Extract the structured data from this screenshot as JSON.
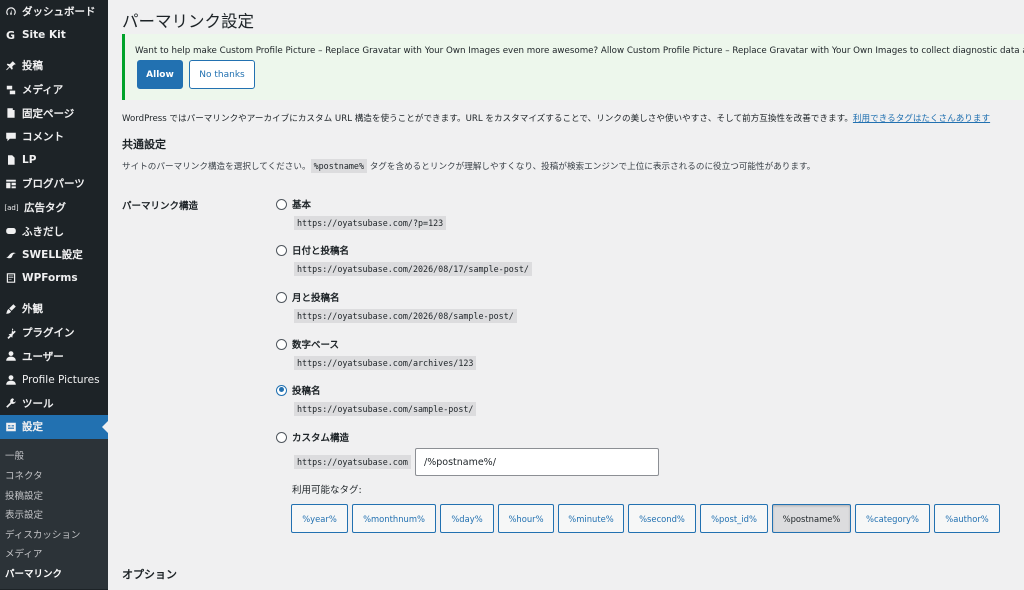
{
  "sidebar": {
    "items": [
      {
        "label": "ダッシュボード",
        "icon": "dashboard-icon"
      },
      {
        "label": "Site Kit",
        "icon": "site-kit-icon"
      },
      {
        "label": "投稿",
        "icon": "pin-icon"
      },
      {
        "label": "メディア",
        "icon": "media-icon"
      },
      {
        "label": "固定ページ",
        "icon": "page-icon"
      },
      {
        "label": "コメント",
        "icon": "comment-icon"
      },
      {
        "label": "LP",
        "icon": "document-icon"
      },
      {
        "label": "ブログパーツ",
        "icon": "blocks-icon"
      },
      {
        "label": "広告タグ",
        "icon": "ad-icon",
        "icon_text": "[ad]"
      },
      {
        "label": "ふきだし",
        "icon": "speech-bubble-icon"
      },
      {
        "label": "SWELL設定",
        "icon": "swell-icon"
      },
      {
        "label": "WPForms",
        "icon": "wpforms-icon"
      },
      {
        "label": "外観",
        "icon": "brush-icon"
      },
      {
        "label": "プラグイン",
        "icon": "plugin-icon"
      },
      {
        "label": "ユーザー",
        "icon": "user-icon"
      },
      {
        "label": "Profile Pictures",
        "icon": "profile-icon"
      },
      {
        "label": "ツール",
        "icon": "wrench-icon"
      },
      {
        "label": "設定",
        "icon": "settings-icon"
      }
    ],
    "submenu": [
      "一般",
      "コネクタ",
      "投稿設定",
      "表示設定",
      "ディスカッション",
      "メディア",
      "パーマリンク"
    ]
  },
  "page": {
    "title": "パーマリンク設定"
  },
  "notice": {
    "text": "Want to help make Custom Profile Picture – Replace Gravatar with Your Own Images even more awesome? Allow Custom Profile Picture – Replace Gravatar with Your Own Images to collect diagnostic data and usage information.",
    "allow_label": "Allow",
    "no_thanks_label": "No thanks"
  },
  "intro": {
    "text": "WordPress ではパーマリンクやアーカイブにカスタム URL 構造を使うことができます。URL をカスタマイズすることで、リンクの美しさや使いやすさ、そして前方互換性を改善できます。",
    "link": "利用できるタグはたくさんあります"
  },
  "common": {
    "title": "共通設定",
    "desc_before": "サイトのパーマリンク構造を選択してください。",
    "desc_code": "%postname%",
    "desc_after": " タグを含めるとリンクが理解しやすくなり、投稿が検索エンジンで上位に表示されるのに役立つ可能性があります。",
    "structure_label": "パーマリンク構造"
  },
  "options": [
    {
      "label": "基本",
      "url": "https://oyatsubase.com/?p=123",
      "checked": false
    },
    {
      "label": "日付と投稿名",
      "url": "https://oyatsubase.com/2026/08/17/sample-post/",
      "checked": false
    },
    {
      "label": "月と投稿名",
      "url": "https://oyatsubase.com/2026/08/sample-post/",
      "checked": false
    },
    {
      "label": "数字ベース",
      "url": "https://oyatsubase.com/archives/123",
      "checked": false
    },
    {
      "label": "投稿名",
      "url": "https://oyatsubase.com/sample-post/",
      "checked": true
    },
    {
      "label": "カスタム構造",
      "checked": false
    }
  ],
  "custom": {
    "prefix": "https://oyatsubase.com",
    "value": "/%postname%/",
    "tags_label": "利用可能なタグ:"
  },
  "tags": [
    {
      "label": "%year%",
      "pressed": false
    },
    {
      "label": "%monthnum%",
      "pressed": false
    },
    {
      "label": "%day%",
      "pressed": false
    },
    {
      "label": "%hour%",
      "pressed": false
    },
    {
      "label": "%minute%",
      "pressed": false
    },
    {
      "label": "%second%",
      "pressed": false
    },
    {
      "label": "%post_id%",
      "pressed": false
    },
    {
      "label": "%postname%",
      "pressed": true
    },
    {
      "label": "%category%",
      "pressed": false
    },
    {
      "label": "%author%",
      "pressed": false
    }
  ],
  "options_section": {
    "title": "オプション"
  },
  "colors": {
    "sidebar_bg": "#1d2327",
    "accent": "#2271b1",
    "notice_border": "#00a32a"
  }
}
